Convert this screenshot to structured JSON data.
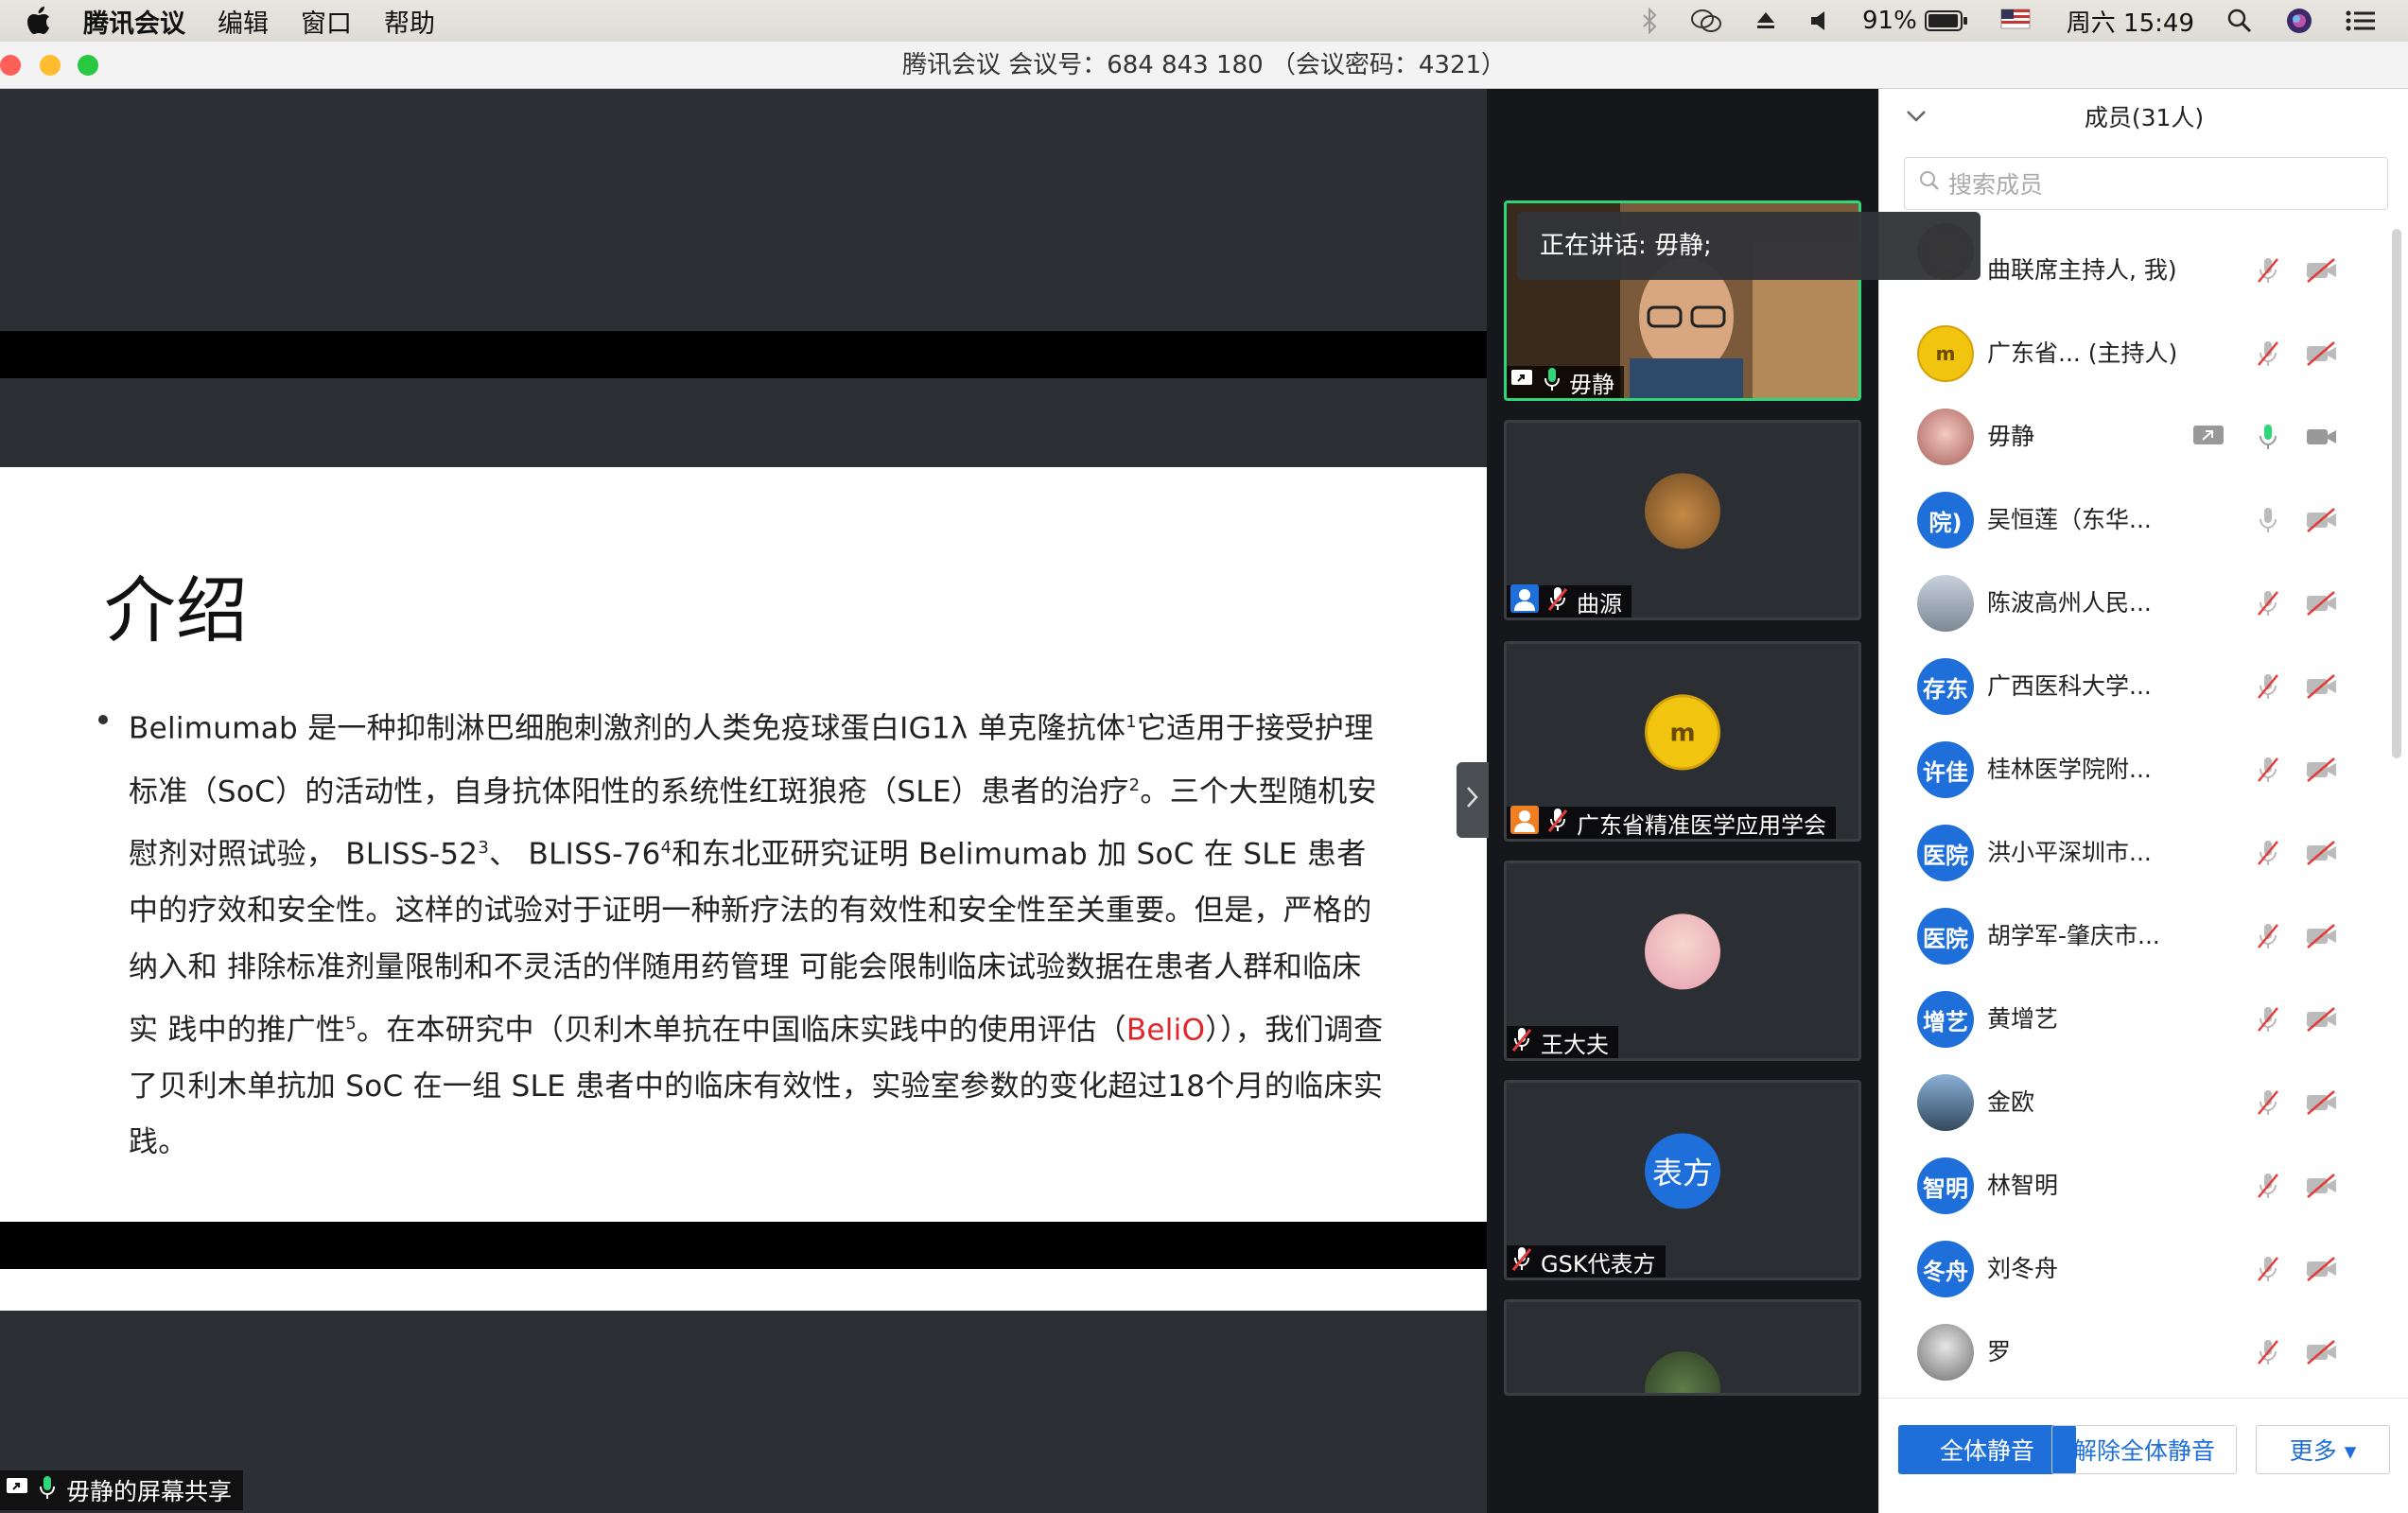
{
  "menubar": {
    "app_name": "腾讯会议",
    "items": [
      "编辑",
      "窗口",
      "帮助"
    ],
    "battery": "91%",
    "clock": "周六 15:49"
  },
  "window": {
    "title": "腾讯会议 会议号：684 843 180 （会议密码：4321）"
  },
  "slide": {
    "title": "介绍",
    "body_parts": {
      "p1": "Belimumab 是一种抑制淋巴细胞刺激剂的人类免疫球蛋白IG1λ 单克隆抗体",
      "s1": "1",
      "p2": "它适用于接受护理标准（SoC）的活动性，自身抗体阳性的系统性红斑狼疮（SLE）患者的治疗",
      "s2": "2",
      "p3": "。三个大型随机安慰剂对照试验， BLISS-52",
      "s3": "3",
      "p4": "、 BLISS-76",
      "s4": "4",
      "p5": "和东北亚研究证明 Belimumab 加 SoC 在 SLE 患者中的疗效和安全性。这样的试验对于证明一种新疗法的有效性和安全性至关重要。但是，严格的纳入和 排除标准剂量限制和不灵活的伴随用药管理 可能会限制临床试验数据在患者人群和临床实 践中的推广性",
      "s5": "5",
      "p6": "。在本研究中（贝利木单抗在中国临床实践中的使用评估（",
      "red": "BeliO",
      "p7": "）），我们调查了贝利木单抗加 SoC 在一组 SLE 患者中的临床有效性，实验室参数的变化超过18个月的临床实践。"
    }
  },
  "share_label": "毋静的屏幕共享",
  "speaking_tip": "正在讲话: 毋静;",
  "video_tiles": [
    {
      "name": "毋静"
    },
    {
      "name": "曲源"
    },
    {
      "name": "广东省精准医学应用学会"
    },
    {
      "name": "王大夫"
    },
    {
      "name": "GSK代表方",
      "avatar_text": "表方"
    },
    {
      "name": ""
    }
  ],
  "panel": {
    "title": "成员(31人)",
    "search_placeholder": "搜索成员",
    "members": [
      {
        "name": "曲联席主持人, 我)",
        "avatar": ""
      },
      {
        "name": "广东省... (主持人)",
        "avatar": ""
      },
      {
        "name": "毋静",
        "avatar": ""
      },
      {
        "name": "吴恒莲（东华...",
        "avatar": "院)"
      },
      {
        "name": "陈波高州人民...",
        "avatar": ""
      },
      {
        "name": "广西医科大学...",
        "avatar": "存东"
      },
      {
        "name": "桂林医学院附...",
        "avatar": "许佳"
      },
      {
        "name": "洪小平深圳市...",
        "avatar": "医院"
      },
      {
        "name": "胡学军-肇庆市...",
        "avatar": "医院"
      },
      {
        "name": "黄增艺",
        "avatar": "增艺"
      },
      {
        "name": "金欧",
        "avatar": ""
      },
      {
        "name": "林智明",
        "avatar": "智明"
      },
      {
        "name": "刘冬舟",
        "avatar": "冬舟"
      },
      {
        "name": "罗",
        "avatar": ""
      }
    ],
    "btn_mute_all": "全体静音",
    "btn_unmute_all": "解除全体静音",
    "btn_more": "更多 ▾"
  },
  "colors": {
    "accent": "#1e6fd9",
    "active_border": "#2fd67a",
    "muted_red": "#e23c3c"
  }
}
